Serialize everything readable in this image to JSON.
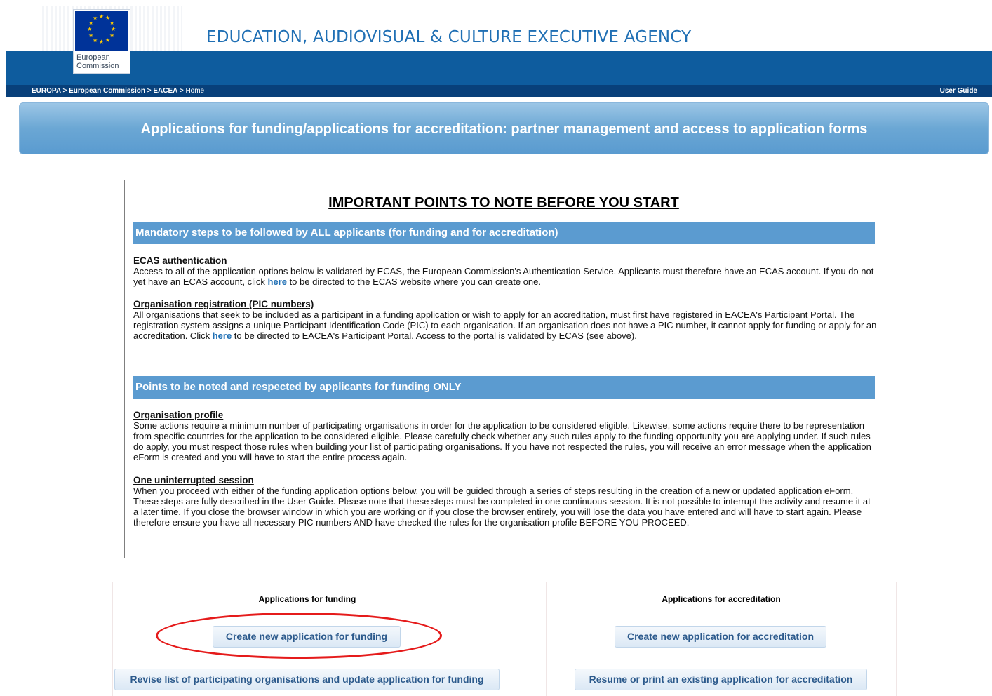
{
  "header": {
    "logo_lines": [
      "European",
      "Commission"
    ],
    "agency_title": "EDUCATION, AUDIOVISUAL & CULTURE EXECUTIVE AGENCY"
  },
  "breadcrumb": {
    "items": [
      "EUROPA",
      "European Commission",
      "EACEA",
      "Home"
    ],
    "separator": ">",
    "user_guide": "User Guide"
  },
  "page": {
    "title": "Applications for funding/applications for accreditation: partner management and access to application forms"
  },
  "notes": {
    "heading": "IMPORTANT POINTS TO NOTE BEFORE YOU START",
    "section1": {
      "title": "Mandatory steps to be followed by ALL applicants (for funding and for accreditation)",
      "ecas": {
        "title": "ECAS authentication",
        "text_before": "Access to all of the application options below is validated by ECAS, the European Commission's Authentication Service. Applicants must therefore have an ECAS account. If you do not yet have an ECAS account, click ",
        "link": "here",
        "text_after": " to be directed to the ECAS website where you can create one."
      },
      "pic": {
        "title": "Organisation registration (PIC numbers)",
        "text_before": "All organisations that seek to be included as a participant in a funding application or wish to apply for an accreditation, must first have registered in EACEA's Participant Portal. The registration system assigns a unique Participant Identification Code (PIC) to each organisation. If an organisation does not have a PIC number, it cannot apply for funding or apply for an accreditation. Click ",
        "link": "here",
        "text_after": " to be directed to EACEA's Participant Portal. Access to the portal is validated by ECAS (see above)."
      }
    },
    "section2": {
      "title": "Points to be noted and respected by applicants for funding ONLY",
      "profile": {
        "title": "Organisation profile",
        "text": "Some actions require a minimum number of participating organisations in order for the application to be considered eligible. Likewise, some actions require there to be representation from specific countries for the application to be considered eligible. Please carefully check whether any such rules apply to the funding opportunity you are applying under. If such rules do apply, you must respect those rules when building your list of participating organisations. If you have not respected the rules, you will receive an error message when the application eForm is created and you will have to start the entire process again."
      },
      "session": {
        "title": "One uninterrupted session",
        "text": "When you proceed with either of the funding application options below, you will be guided through a series of steps resulting in the creation of a new or updated application eForm. These steps are fully described in the User Guide. Please note that these steps must be completed in one continuous session. It is not possible to interrupt the activity and resume it at a later time. If you close the browser window in which you are working or if you close the browser entirely, you will lose the data you have entered and will have to start again. Please therefore ensure you have all necessary PIC numbers AND have checked the rules for the organisation profile BEFORE YOU PROCEED."
      }
    }
  },
  "funding_panel": {
    "title": "Applications for funding",
    "create_button": "Create new application for funding",
    "revise_button": "Revise list of participating organisations and update application for funding"
  },
  "accreditation_panel": {
    "title": "Applications for accreditation",
    "create_button": "Create new application for accreditation",
    "resume_button": "Resume or print an existing application for accreditation"
  },
  "colors": {
    "brand_blue": "#0e5c9e",
    "breadcrumb_bar": "#08407a",
    "section_bar": "#5b9bd0",
    "highlight_ellipse": "#e51b1b"
  }
}
